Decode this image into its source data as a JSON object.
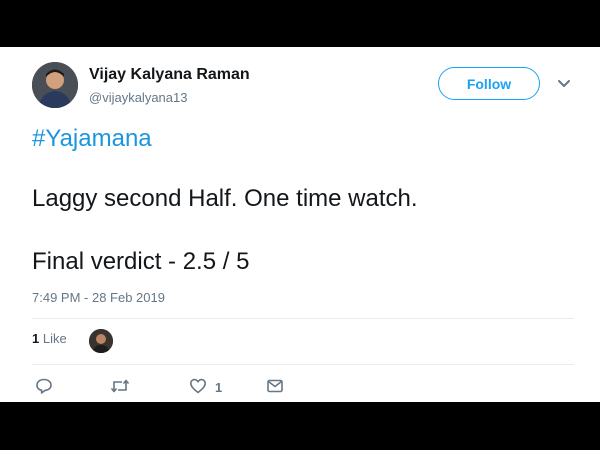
{
  "tweet": {
    "author_name": "Vijay Kalyana Raman",
    "author_handle": "@vijaykalyana13",
    "follow_label": "Follow",
    "hashtag": "#Yajamana",
    "text_line1": "Laggy second Half. One time watch.",
    "text_line2": "Final verdict - 2.5 / 5",
    "timestamp": "7:49 PM - 28 Feb 2019",
    "likes_count": "1",
    "likes_label": "Like",
    "action_like_count": "1"
  },
  "icons": [
    "reply-icon",
    "retweet-icon",
    "like-icon",
    "direct-message-icon",
    "chevron-down-icon"
  ],
  "colors": {
    "accent": "#1da1f2",
    "text": "#14171a",
    "muted": "#657786",
    "frame": "#000000"
  }
}
